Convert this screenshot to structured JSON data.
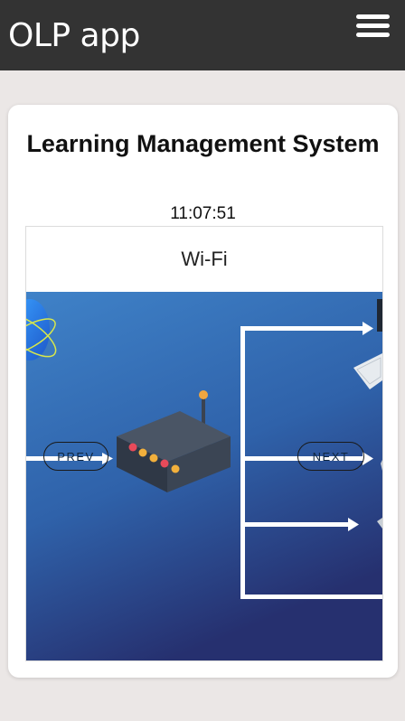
{
  "header": {
    "app_title": "OLP app",
    "menu_icon": "hamburger-menu-icon"
  },
  "card": {
    "title": "Learning Management System",
    "clock": "11:07:51",
    "slider": {
      "slide_caption": "Wi-Fi",
      "prev_label": "PREV",
      "next_label": "NEXT"
    }
  },
  "colors": {
    "topbar": "#333333",
    "page_background": "#ebe7e6",
    "card_background": "#ffffff",
    "slide_gradient_top": "#3c78c0",
    "slide_gradient_bottom": "#27306f"
  }
}
